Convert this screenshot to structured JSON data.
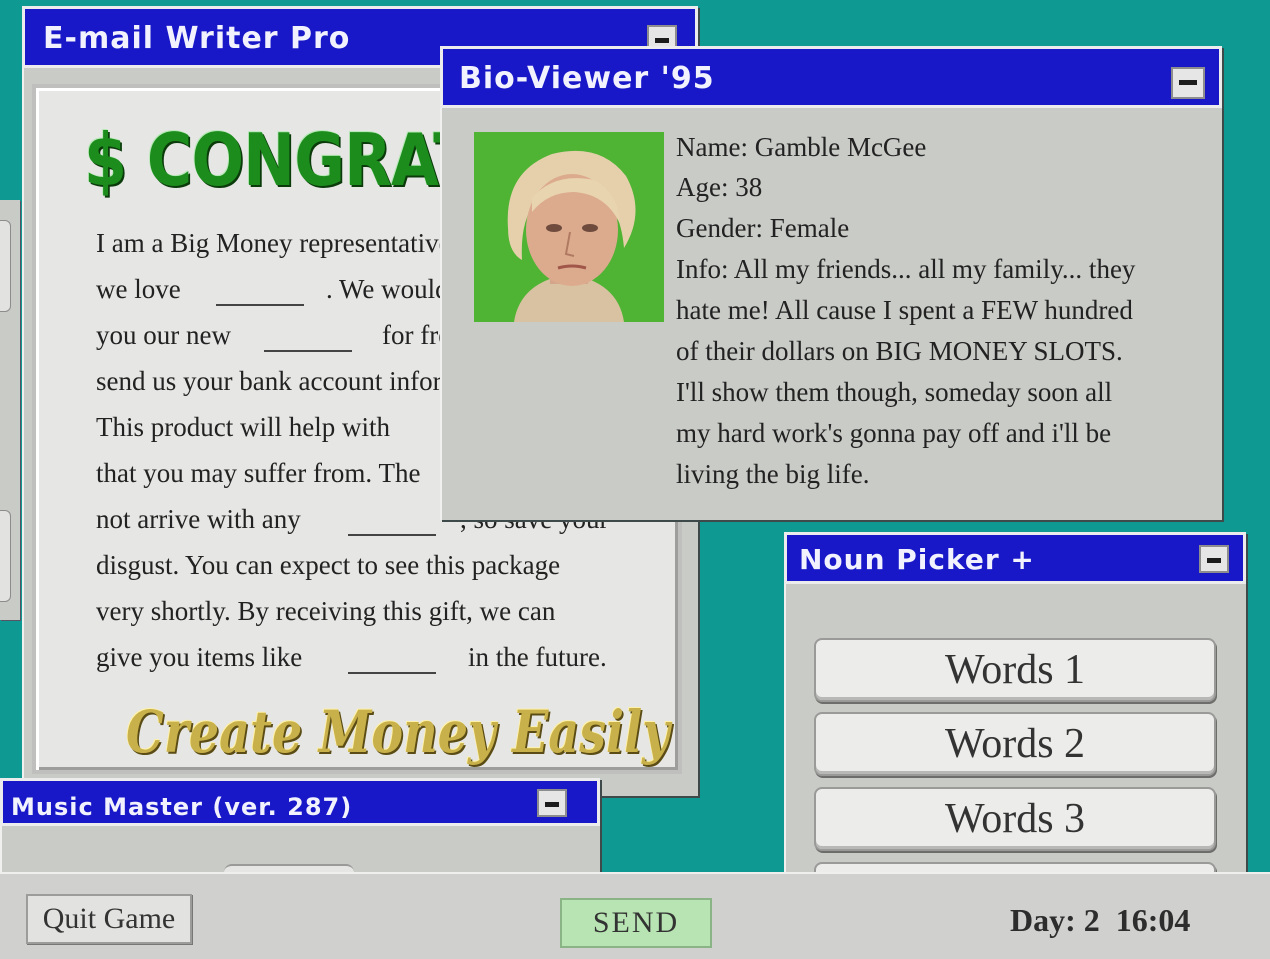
{
  "email_window": {
    "title": "E-mail Writer Pro",
    "headline": "$ CONGRATULATIONS",
    "lines": [
      "I am a Big Money representative",
      "we love",
      ". We would like to send",
      "you our new",
      "for free! Please",
      "send us your bank account information.",
      "This product will help with",
      "that you may suffer from. The",
      "not arrive with any",
      ", so save your",
      "disgust. You can expect to see this package",
      "very shortly. By receiving this gift, we can",
      "give you items like",
      "in the future."
    ],
    "tagline": "Create Money Easily"
  },
  "music_window": {
    "title": "Music Master (ver. 287)"
  },
  "bio_window": {
    "title": "Bio-Viewer '95",
    "name": "Name: Gamble McGee",
    "age": "Age: 38",
    "gender": "Gender: Female",
    "info_lines": [
      "Info: All my friends... all my family... they",
      "hate me! All cause I spent a FEW hundred",
      "of their dollars on BIG MONEY SLOTS.",
      "I'll show them though, someday soon all",
      "my hard work's gonna pay off and i'll be",
      "living the big life."
    ],
    "portrait_bg": "#4fb334"
  },
  "noun_picker": {
    "title": "Noun Picker +",
    "options": [
      "Words 1",
      "Words 2",
      "Words 3"
    ]
  },
  "bottom_bar": {
    "quit_label": "Quit Game",
    "send_label": "SEND",
    "day_label": "Day: 2",
    "time": "16:04"
  },
  "colors": {
    "desktop": "#0e9a92",
    "titlebar": "#1818c8",
    "window": "#c9cbc7",
    "send": "#b7e4b2"
  }
}
